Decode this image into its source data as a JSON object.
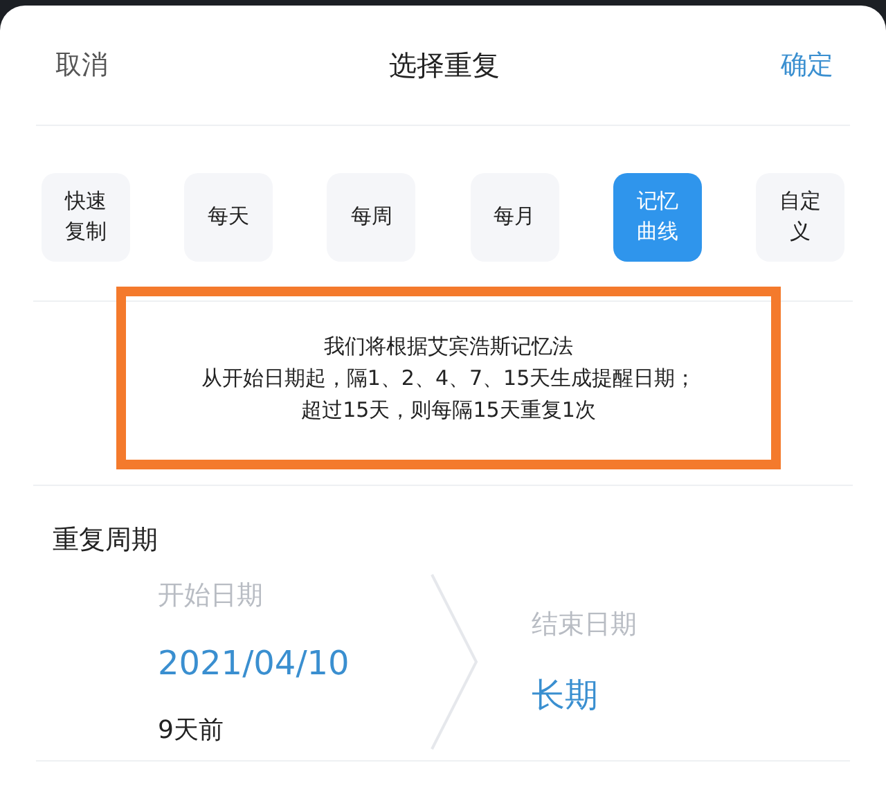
{
  "header": {
    "cancel": "取消",
    "title": "选择重复",
    "confirm": "确定"
  },
  "options": [
    {
      "label": "快速复制",
      "selected": false
    },
    {
      "label": "每天",
      "selected": false
    },
    {
      "label": "每周",
      "selected": false
    },
    {
      "label": "每月",
      "selected": false
    },
    {
      "label": "记忆曲线",
      "selected": true
    },
    {
      "label": "自定义",
      "selected": false
    }
  ],
  "description": {
    "highlighted": true,
    "lines": [
      "我们将根据艾宾浩斯记忆法",
      "从开始日期起，隔1、2、4、7、15天生成提醒日期；",
      "超过15天，则每隔15天重复1次"
    ]
  },
  "period": {
    "title": "重复周期",
    "start_label": "开始日期",
    "start_value": "2021/04/10",
    "start_note": "9天前",
    "end_label": "结束日期",
    "end_value": "长期"
  }
}
